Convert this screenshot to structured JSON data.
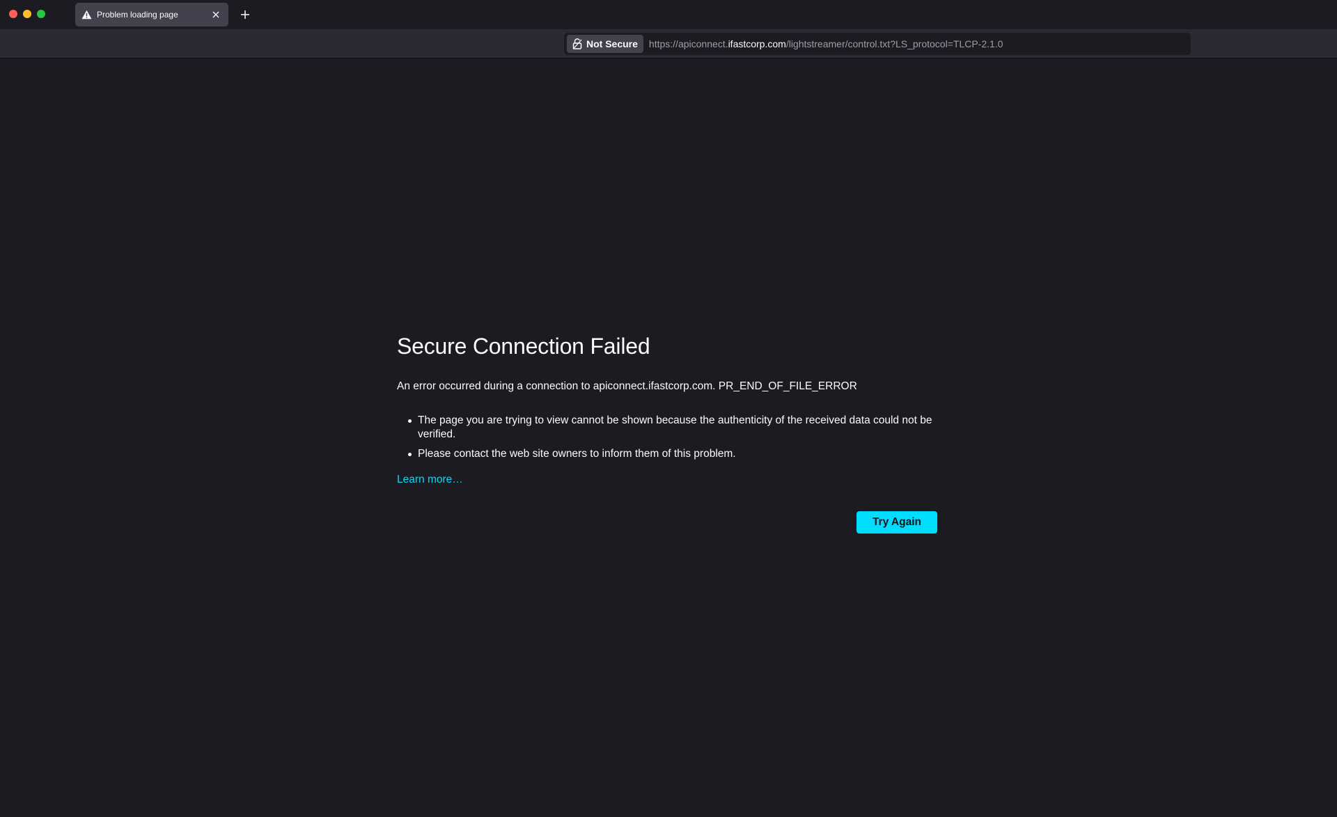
{
  "tabs": [
    {
      "title": "Problem loading page",
      "icon": "warning-icon"
    }
  ],
  "urlbar": {
    "security_label": "Not Secure",
    "url_prefix": "https://apiconnect.",
    "url_domain": "ifastcorp.com",
    "url_suffix": "/lightstreamer/control.txt?LS_protocol=TLCP-2.1.0"
  },
  "error": {
    "title": "Secure Connection Failed",
    "short_desc": "An error occurred during a connection to apiconnect.ifastcorp.com. PR_END_OF_FILE_ERROR",
    "details": [
      "The page you are trying to view cannot be shown because the authenticity of the received data could not be verified.",
      "Please contact the web site owners to inform them of this problem."
    ],
    "learn_more": "Learn more…",
    "try_again": "Try Again"
  },
  "colors": {
    "background": "#1c1b22",
    "accent": "#00ddff",
    "close": "#ff5f57",
    "minimize": "#febc2e",
    "maximize": "#28c840"
  }
}
